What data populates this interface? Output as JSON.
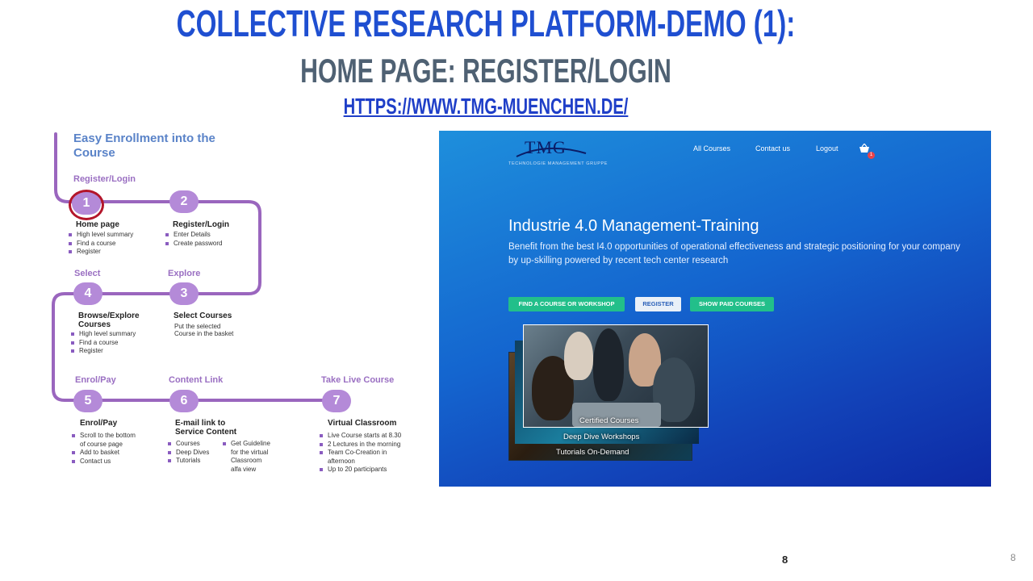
{
  "slide": {
    "title": "Collective Research Platform-Demo (1):",
    "subtitle": "Home Page: Register/Login",
    "link": "https://www.tmg-muenchen.de/",
    "page_number_center": "8",
    "page_number_corner": "8"
  },
  "flow": {
    "heading": "Easy Enrollment into the Course",
    "phases": {
      "register_login": "Register/Login",
      "select": "Select",
      "explore": "Explore",
      "enrol_pay": "Enrol/Pay",
      "content_link": "Content Link",
      "take_live": "Take Live Course"
    },
    "steps": [
      {
        "number": "1",
        "title": "Home page",
        "bullets": [
          "High level summary",
          "Find a course",
          "Register"
        ]
      },
      {
        "number": "2",
        "title": "Register/Login",
        "bullets": [
          "Enter Details",
          "Create password"
        ]
      },
      {
        "number": "3",
        "title": "Select Courses",
        "plain": [
          "Put the selected",
          "Course in the basket"
        ]
      },
      {
        "number": "4",
        "title_lines": [
          "Browse/Explore",
          "Courses"
        ],
        "bullets": [
          "High level summary",
          "Find a course",
          "Register"
        ]
      },
      {
        "number": "5",
        "title": "Enrol/Pay",
        "bullets": [
          "Scroll to the bottom",
          "Add to basket",
          "Contact us"
        ],
        "bullet_cont": "of course page"
      },
      {
        "number": "6",
        "title_lines": [
          "E-mail link to",
          "Service Content"
        ],
        "bullets": [
          "Courses",
          "Deep Dives",
          "Tutorials"
        ],
        "extra_bullet": "Get Guideline",
        "extra_lines": [
          "for the virtual",
          "Classroom",
          "alfa view"
        ]
      },
      {
        "number": "7",
        "title": "Virtual Classroom",
        "bullets": [
          "Live Course starts at 8.30",
          "2 Lectures in the morning",
          "Team Co-Creation in",
          "Up to 20 participants"
        ],
        "bullet_cont": "afternoon"
      }
    ]
  },
  "site": {
    "logo_text": "TMG",
    "logo_sub": "TECHNOLOGIE MANAGEMENT GRUPPE",
    "nav": {
      "all_courses": "All Courses",
      "contact_us": "Contact us",
      "logout": "Logout"
    },
    "cart_count": "1",
    "hero_title": "Industrie 4.0 Management-Training",
    "hero_desc": "Benefit from the best I4.0 opportunities of operational effectiveness and strategic positioning for your company by up-skilling powered by recent tech center research",
    "buttons": {
      "find": "FIND A COURSE OR WORKSHOP",
      "register": "REGISTER",
      "paid": "SHOW PAID COURSES"
    },
    "cards": {
      "certified": "Certified Courses",
      "deep_dive": "Deep Dive Workshops",
      "tutorials": "Tutorials On-Demand"
    },
    "colors": {
      "accent_green": "#22bf8a",
      "step_purple": "#b48ad8",
      "title_blue": "#1f4fd1"
    }
  }
}
